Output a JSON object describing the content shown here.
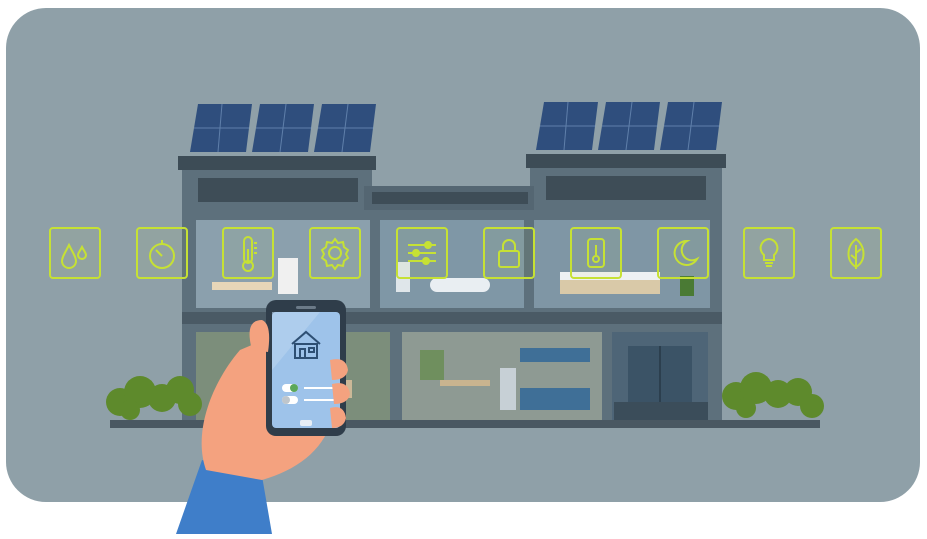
{
  "scene": {
    "colors": {
      "background": "#8fa0a8",
      "building": "#5f7380",
      "accent_icons": "#c6e134",
      "phone_screen": "#9ec3ea",
      "hand": "#f4a27f",
      "sleeve": "#3f7ec9",
      "plants": "#5e8a2c"
    },
    "smart_icons": [
      {
        "name": "water-drops-icon"
      },
      {
        "name": "timer-icon"
      },
      {
        "name": "thermometer-icon"
      },
      {
        "name": "gear-icon"
      },
      {
        "name": "sliders-icon"
      },
      {
        "name": "padlock-icon"
      },
      {
        "name": "thermostat-icon"
      },
      {
        "name": "moon-icon"
      },
      {
        "name": "light-bulb-icon"
      },
      {
        "name": "leaf-icon"
      }
    ],
    "phone": {
      "toggles": [
        {
          "state": "on"
        },
        {
          "state": "off"
        }
      ]
    }
  }
}
